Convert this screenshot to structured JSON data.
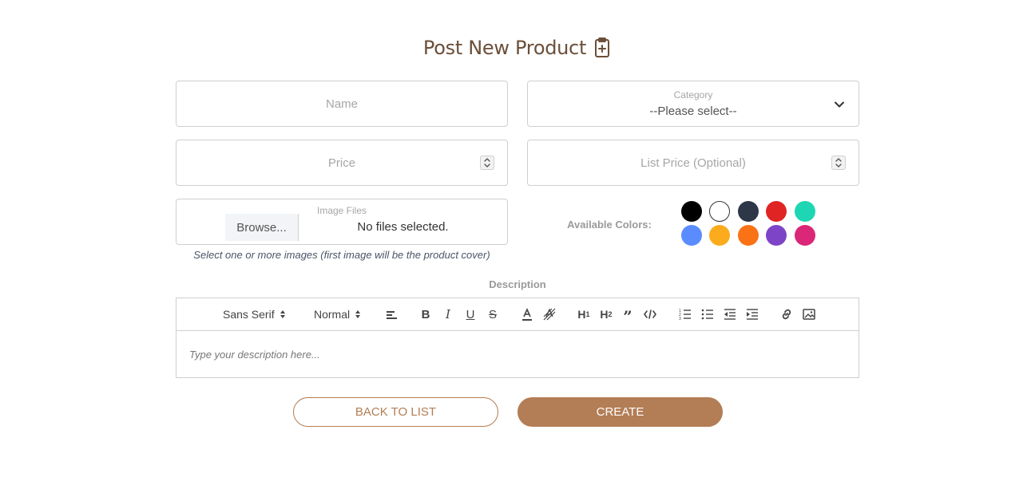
{
  "header": {
    "title": "Post New Product",
    "icon": "clipboard-plus-icon"
  },
  "form": {
    "name": {
      "placeholder": "Name"
    },
    "category": {
      "label": "Category",
      "selected": "--Please select--"
    },
    "price": {
      "placeholder": "Price"
    },
    "list_price": {
      "placeholder": "List Price (Optional)"
    },
    "images": {
      "label": "Image Files",
      "browse_label": "Browse...",
      "status": "No files selected.",
      "hint": "Select one or more images (first image will be the product cover)"
    },
    "colors": {
      "label": "Available Colors:",
      "swatches": [
        "#000000",
        "#ffffff",
        "#2d3748",
        "#e02424",
        "#1ed6b4",
        "#5b8cff",
        "#fbab1c",
        "#f97316",
        "#7e44c7",
        "#db2777"
      ]
    },
    "description": {
      "label": "Description",
      "font_select": "Sans Serif",
      "size_select": "Normal",
      "placeholder": "Type your description here..."
    }
  },
  "actions": {
    "back_label": "BACK TO LIST",
    "create_label": "CREATE"
  },
  "theme": {
    "accent": "#b37d55",
    "title_color": "#6b4f3a"
  }
}
